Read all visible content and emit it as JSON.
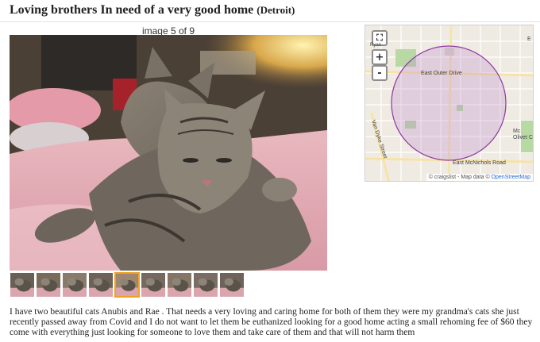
{
  "header": {
    "title": "Loving brothers In need of a very good home",
    "location": "(Detroit)"
  },
  "gallery": {
    "counter": "image 5 of 9",
    "selected_index": 5,
    "thumbnail_count": 9
  },
  "map": {
    "zoom_in_label": "+",
    "zoom_out_label": "-",
    "street_east_outer_drive": "East Outer Drive",
    "street_east_mcnichols": "East McNichols Road",
    "street_vertical": "Van Dyke Street",
    "label_olivet": "Olivet C",
    "label_mo": "Mc",
    "label_top_left": "Ryan",
    "label_top_right": "E",
    "attribution_prefix": "© craigslist - Map data ©",
    "attribution_link": "OpenStreetMap",
    "circle_color": "#b980c8"
  },
  "description": "I have two beautiful cats Anubis and Rae . That needs a very loving and caring home for both of them they were my grandma's cats she just recently passed away from Covid and I do not want to let them be euthanized looking for a good home acting a small rehoming fee of $60 they come with everything just looking for someone to love them and take care of them and that will not harm them"
}
